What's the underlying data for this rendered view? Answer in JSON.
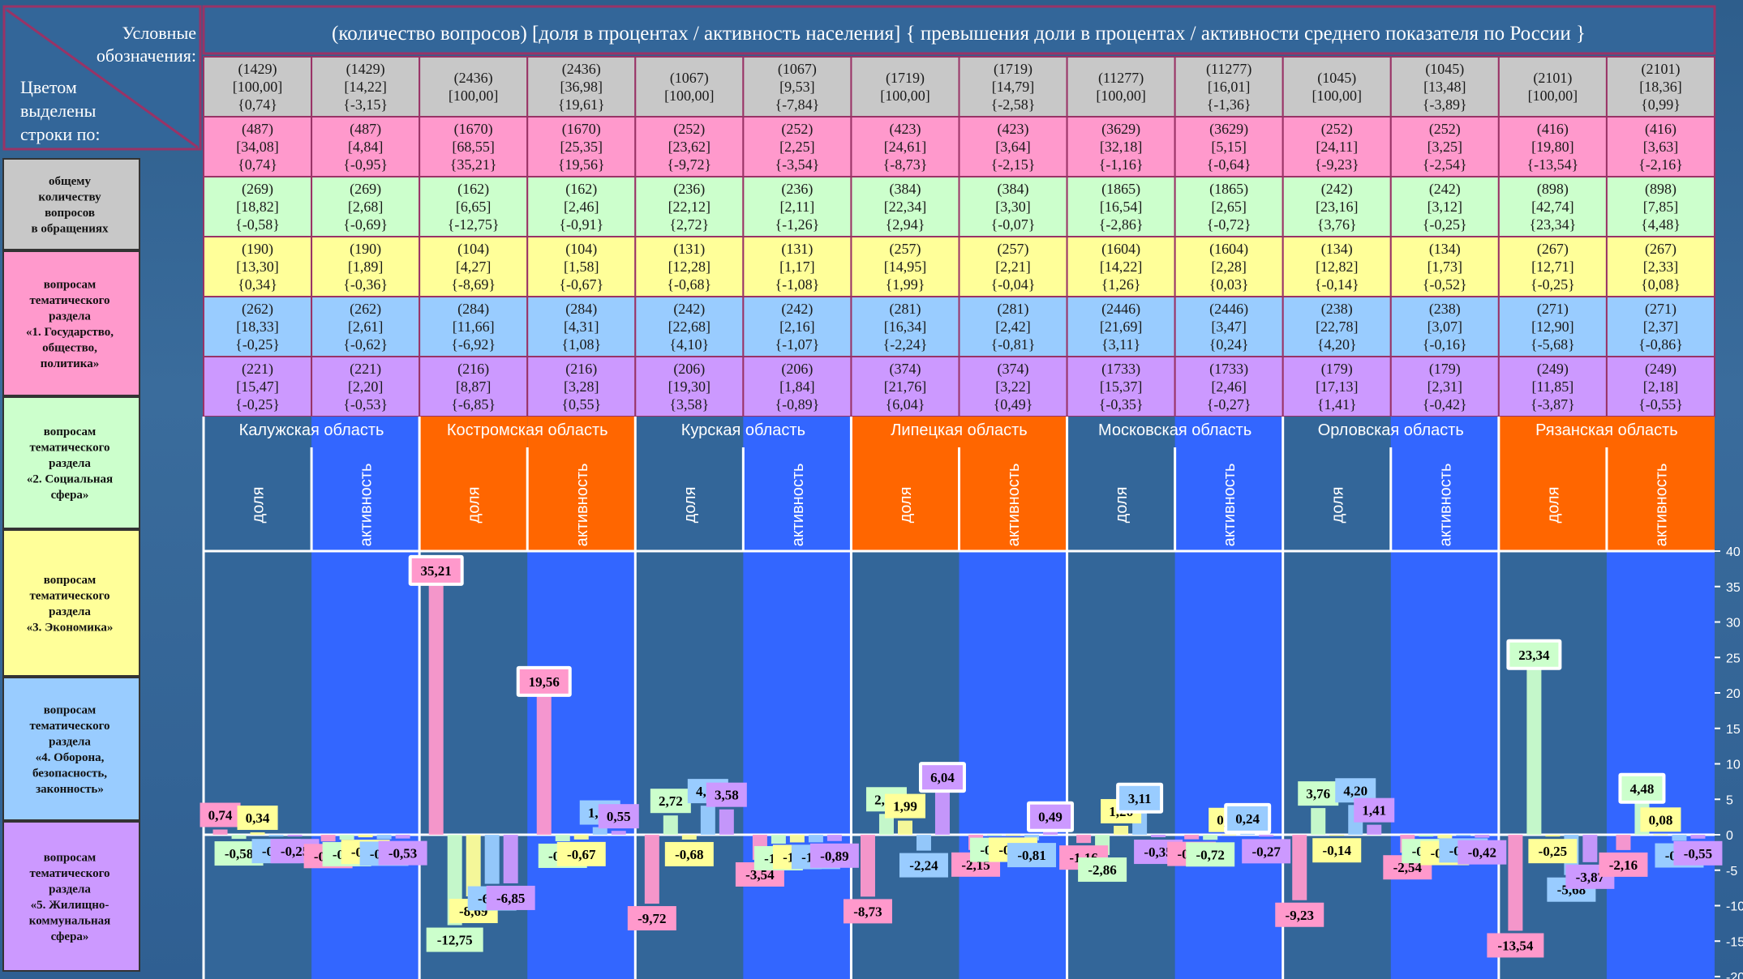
{
  "legend": {
    "title": "Условные обозначения:",
    "color_note": "Цветом выделены строки по:",
    "rows": [
      {
        "text": "общему количеству вопросов в обращениях",
        "color": "#c8c8c8"
      },
      {
        "text": "вопросам тематического раздела «1. Государство, общество, политика»",
        "color": "#ff99cc"
      },
      {
        "text": "вопросам тематического раздела «2. Социальная сфера»",
        "color": "#ccffcc"
      },
      {
        "text": "вопросам тематического раздела «3. Экономика»",
        "color": "#ffff99"
      },
      {
        "text": "вопросам тематического раздела «4. Оборона, безопасность, законность»",
        "color": "#99ccff"
      },
      {
        "text": "вопросам тематического раздела «5. Жилищно-коммунальная сфера»",
        "color": "#cc99ff"
      }
    ]
  },
  "header": {
    "text": "(количество вопросов)     [доля в процентах / активность населения]    { превышения  доли в процентах / активности среднего показателя по России }"
  },
  "colors": {
    "row_fills": [
      "#c8c8c8",
      "#ff99cc",
      "#ccffcc",
      "#ffff99",
      "#99ccff",
      "#cc99ff"
    ],
    "band_dark": "#336699",
    "band_orange": "#ff6600",
    "band_blue": "#3366ff"
  },
  "table": {
    "columns": [
      [
        "(1429)\n[100,00]\n{0,74}",
        "(487)\n[34,08]\n{0,74}",
        "(269)\n[18,82]\n{-0,58}",
        "(190)\n[13,30]\n{0,34}",
        "(262)\n[18,33]\n{-0,25}",
        "(221)\n[15,47]\n{-0,25}"
      ],
      [
        "(1429)\n[14,22]\n{-3,15}",
        "(487)\n[4,84]\n{-0,95}",
        "(269)\n[2,68]\n{-0,69}",
        "(190)\n[1,89]\n{-0,36}",
        "(262)\n[2,61]\n{-0,62}",
        "(221)\n[2,20]\n{-0,53}"
      ],
      [
        "(2436)\n[100,00]",
        "(1670)\n[68,55]\n{35,21}",
        "(162)\n[6,65]\n{-12,75}",
        "(104)\n[4,27]\n{-8,69}",
        "(284)\n[11,66]\n{-6,92}",
        "(216)\n[8,87]\n{-6,85}"
      ],
      [
        "(2436)\n[36,98]\n{19,61}",
        "(1670)\n[25,35]\n{19,56}",
        "(162)\n[2,46]\n{-0,91}",
        "(104)\n[1,58]\n{-0,67}",
        "(284)\n[4,31]\n{1,08}",
        "(216)\n[3,28]\n{0,55}"
      ],
      [
        "(1067)\n[100,00]",
        "(252)\n[23,62]\n{-9,72}",
        "(236)\n[22,12]\n{2,72}",
        "(131)\n[12,28]\n{-0,68}",
        "(242)\n[22,68]\n{4,10}",
        "(206)\n[19,30]\n{3,58}"
      ],
      [
        "(1067)\n[9,53]\n{-7,84}",
        "(252)\n[2,25]\n{-3,54}",
        "(236)\n[2,11]\n{-1,26}",
        "(131)\n[1,17]\n{-1,08}",
        "(242)\n[2,16]\n{-1,07}",
        "(206)\n[1,84]\n{-0,89}"
      ],
      [
        "(1719)\n[100,00]",
        "(423)\n[24,61]\n{-8,73}",
        "(384)\n[22,34]\n{2,94}",
        "(257)\n[14,95]\n{1,99}",
        "(281)\n[16,34]\n{-2,24}",
        "(374)\n[21,76]\n{6,04}"
      ],
      [
        "(1719)\n[14,79]\n{-2,58}",
        "(423)\n[3,64]\n{-2,15}",
        "(384)\n[3,30]\n{-0,07}",
        "(257)\n[2,21]\n{-0,04}",
        "(281)\n[2,42]\n{-0,81}",
        "(374)\n[3,22]\n{0,49}"
      ],
      [
        "(11277)\n[100,00]",
        "(3629)\n[32,18]\n{-1,16}",
        "(1865)\n[16,54]\n{-2,86}",
        "(1604)\n[14,22]\n{1,26}",
        "(2446)\n[21,69]\n{3,11}",
        "(1733)\n[15,37]\n{-0,35}"
      ],
      [
        "(11277)\n[16,01]\n{-1,36}",
        "(3629)\n[5,15]\n{-0,64}",
        "(1865)\n[2,65]\n{-0,72}",
        "(1604)\n[2,28]\n{0,03}",
        "(2446)\n[3,47]\n{0,24}",
        "(1733)\n[2,46]\n{-0,27}"
      ],
      [
        "(1045)\n[100,00]",
        "(252)\n[24,11]\n{-9,23}",
        "(242)\n[23,16]\n{3,76}",
        "(134)\n[12,82]\n{-0,14}",
        "(238)\n[22,78]\n{4,20}",
        "(179)\n[17,13]\n{1,41}"
      ],
      [
        "(1045)\n[13,48]\n{-3,89}",
        "(252)\n[3,25]\n{-2,54}",
        "(242)\n[3,12]\n{-0,25}",
        "(134)\n[1,73]\n{-0,52}",
        "(238)\n[3,07]\n{-0,16}",
        "(179)\n[2,31]\n{-0,42}"
      ],
      [
        "(2101)\n[100,00]",
        "(416)\n[19,80]\n{-13,54}",
        "(898)\n[42,74]\n{23,34}",
        "(267)\n[12,71]\n{-0,25}",
        "(271)\n[12,90]\n{-5,68}",
        "(249)\n[11,85]\n{-3,87}"
      ],
      [
        "(2101)\n[18,36]\n{0,99}",
        "(416)\n[3,63]\n{-2,16}",
        "(898)\n[7,85]\n{4,48}",
        "(267)\n[2,33]\n{0,08}",
        "(271)\n[2,37]\n{-0,86}",
        "(249)\n[2,18]\n{-0,55}"
      ]
    ]
  },
  "regions": [
    "Калужская область",
    "Костромская область",
    "Курская область",
    "Липецкая область",
    "Московская область",
    "Орловская область",
    "Рязанская область"
  ],
  "sub_labels": [
    "доля",
    "активность"
  ],
  "chart_data": {
    "type": "bar",
    "categories": [
      "Калужская область",
      "Костромская область",
      "Курская область",
      "Липецкая область",
      "Московская область",
      "Орловская область",
      "Рязанская область"
    ],
    "sub_categories": [
      "доля",
      "активность"
    ],
    "series": [
      {
        "values_share": [
          0.74,
          35.21,
          -9.72,
          -8.73,
          -1.16,
          -9.23,
          -13.54
        ],
        "values_activity": [
          -0.95,
          19.56,
          -3.54,
          -2.15,
          -0.64,
          -2.54,
          -2.16
        ]
      },
      {
        "values_share": [
          -0.58,
          -12.75,
          2.72,
          2.94,
          -2.86,
          3.76,
          23.34
        ],
        "values_activity": [
          -0.69,
          -0.91,
          -1.26,
          -0.07,
          -0.72,
          -0.25,
          4.48
        ]
      },
      {
        "values_share": [
          0.34,
          -8.69,
          -0.68,
          1.99,
          1.26,
          -0.14,
          -0.25
        ],
        "values_activity": [
          -0.36,
          -0.67,
          -1.08,
          -0.04,
          0.03,
          -0.52,
          0.08
        ]
      },
      {
        "values_share": [
          -0.25,
          -6.92,
          4.1,
          -2.24,
          3.11,
          4.2,
          -5.68
        ],
        "values_activity": [
          -0.62,
          1.08,
          -1.07,
          -0.81,
          0.24,
          -0.16,
          -0.86
        ]
      },
      {
        "values_share": [
          -0.25,
          -6.85,
          3.58,
          6.04,
          -0.35,
          1.41,
          -3.87
        ],
        "values_activity": [
          -0.53,
          0.55,
          -0.89,
          0.49,
          -0.27,
          -0.42,
          -0.55
        ]
      }
    ],
    "series_colors": [
      "#ff99cc",
      "#ccffcc",
      "#ffff99",
      "#99ccff",
      "#cc99ff"
    ],
    "highlighted": [
      [
        1,
        0,
        0
      ],
      [
        1,
        0,
        1
      ],
      [
        3,
        4,
        0
      ],
      [
        4,
        3,
        0
      ],
      [
        4,
        3,
        1
      ],
      [
        6,
        1,
        0
      ],
      [
        6,
        1,
        1
      ],
      [
        3,
        4,
        1
      ]
    ],
    "ylim": [
      -20,
      40
    ],
    "yticks": [
      "40",
      "35",
      "30",
      "25",
      "20",
      "15",
      "10",
      "5",
      "0",
      "-5",
      "-10",
      "-15",
      "-20"
    ],
    "ytick_values": [
      40,
      35,
      30,
      25,
      20,
      15,
      10,
      5,
      0,
      -5,
      -10,
      -15,
      -20
    ]
  }
}
